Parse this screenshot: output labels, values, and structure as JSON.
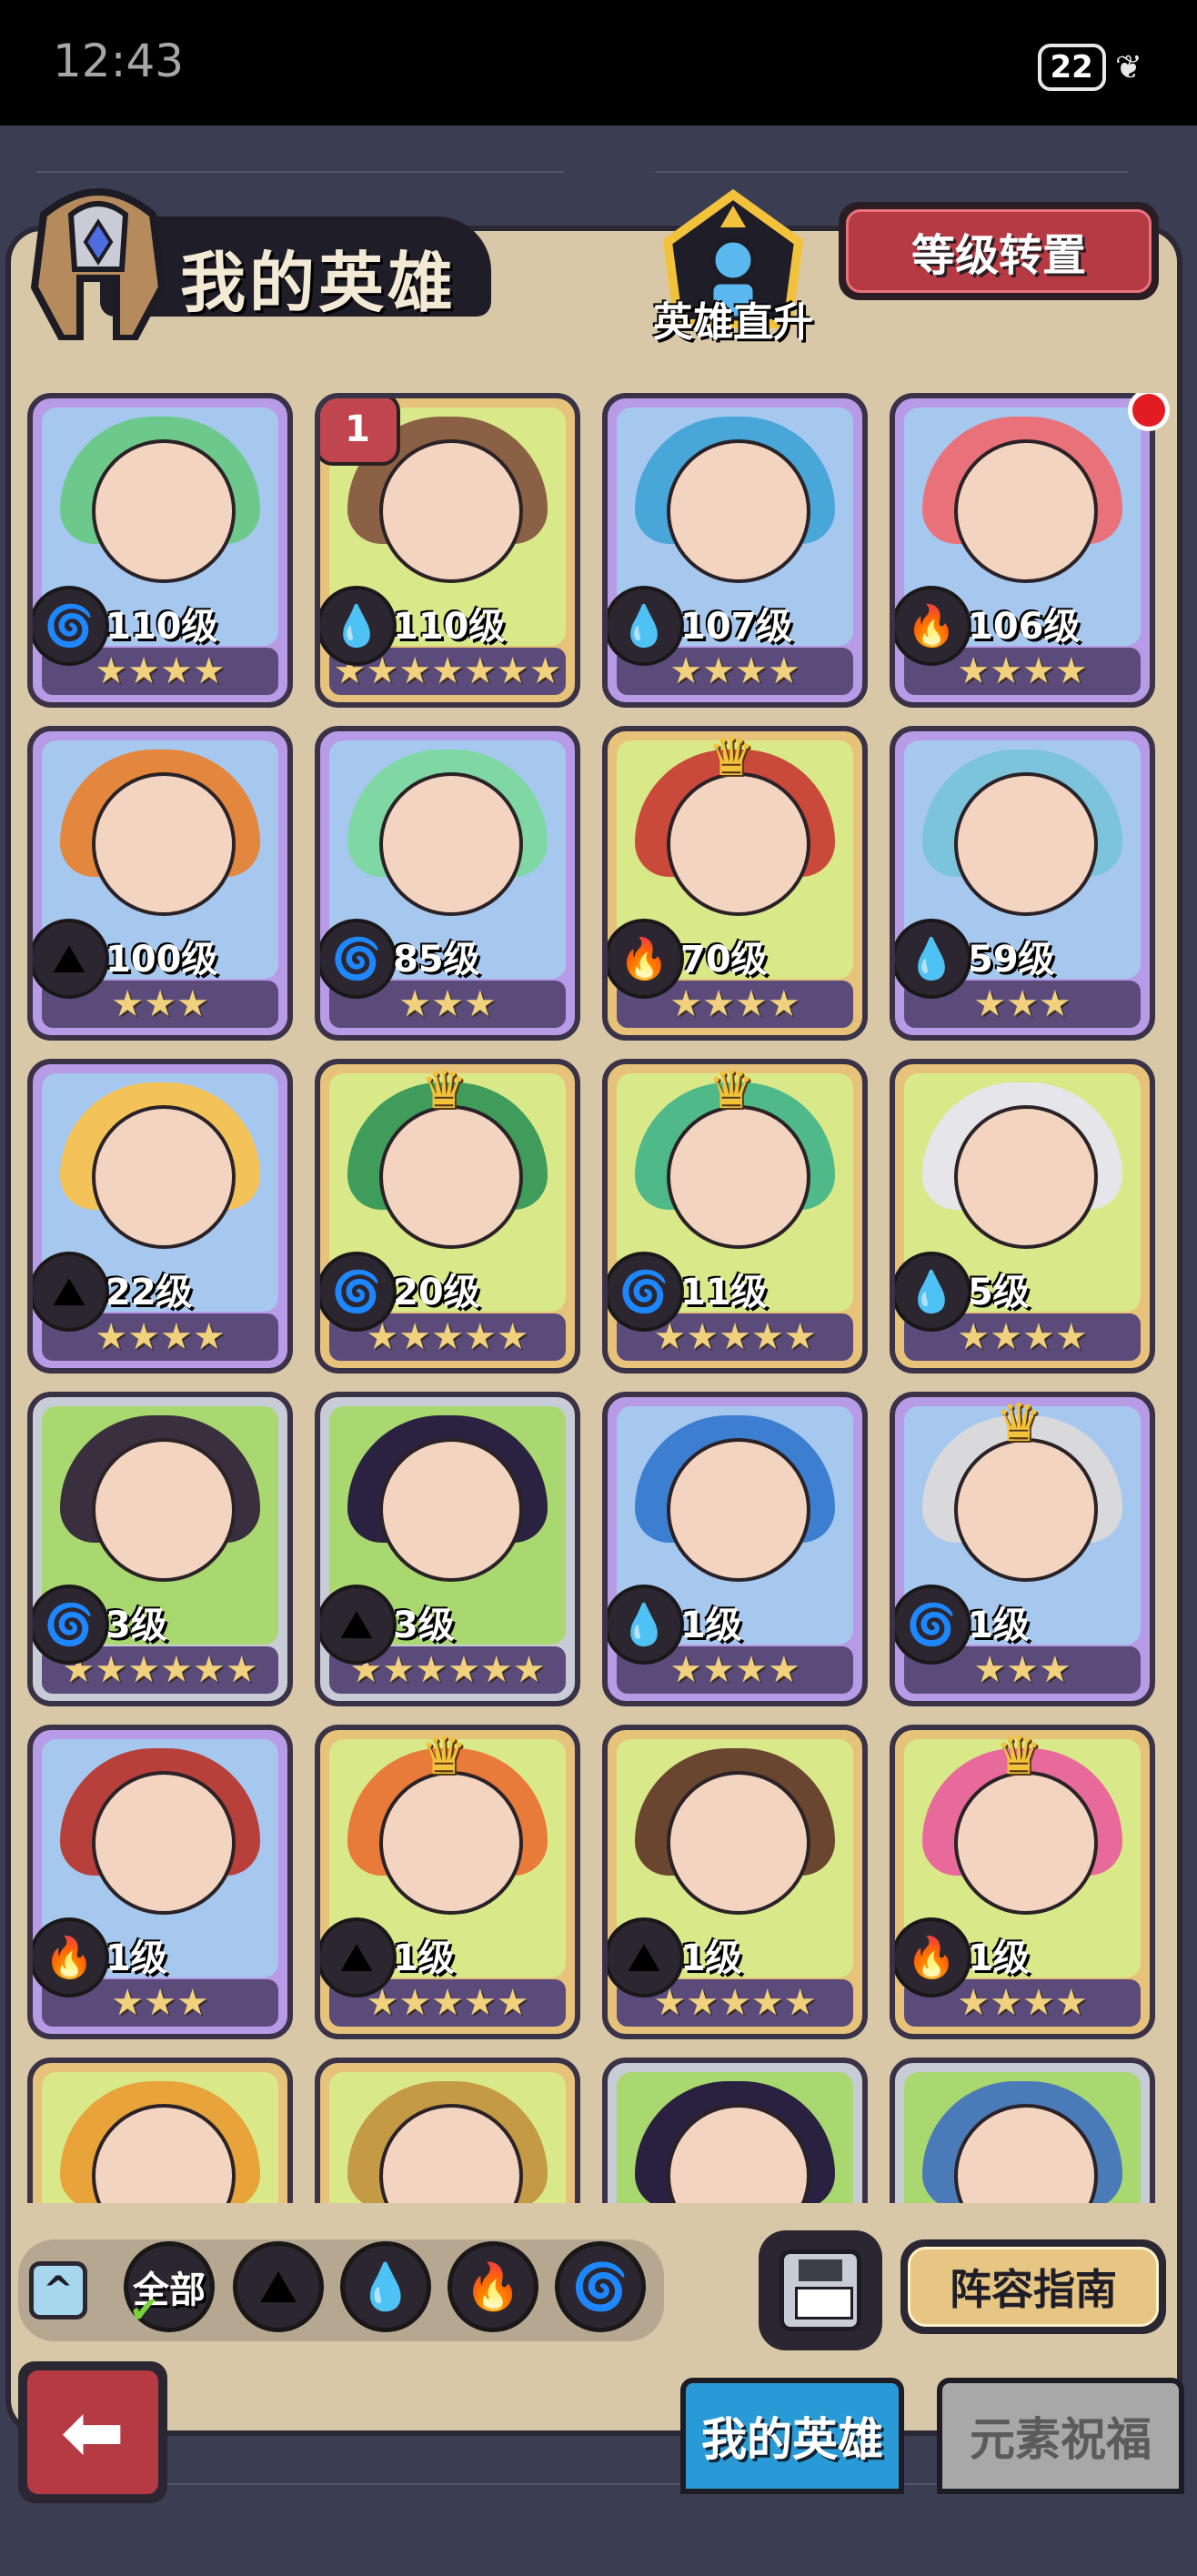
{
  "status_bar": {
    "time": "12:43",
    "battery": "22"
  },
  "header": {
    "title": "我的英雄",
    "rise_label": "英雄直升",
    "level_transfer": "等级转置"
  },
  "heroes": [
    {
      "level": "110级",
      "stars": "★★★★",
      "element": "wind",
      "frame": "purple",
      "color": "#6cc98b"
    },
    {
      "level": "110级",
      "stars": "★★★★★★★",
      "element": "water",
      "frame": "gold",
      "color": "#8a6144",
      "badge": "1"
    },
    {
      "level": "107级",
      "stars": "★★★★",
      "element": "water",
      "frame": "purple",
      "color": "#49a6d8"
    },
    {
      "level": "106级",
      "stars": "★★★★",
      "element": "fire",
      "frame": "purple",
      "color": "#e9727a",
      "dot": true
    },
    {
      "level": "100级",
      "stars": "★★★",
      "element": "earth",
      "frame": "purple",
      "color": "#e2873d"
    },
    {
      "level": "85级",
      "stars": "★★★",
      "element": "wind",
      "frame": "purple",
      "color": "#7fd7a4"
    },
    {
      "level": "70级",
      "stars": "★★★★",
      "element": "fire",
      "frame": "gold",
      "color": "#c94a3a",
      "crown": true
    },
    {
      "level": "59级",
      "stars": "★★★",
      "element": "water",
      "frame": "purple",
      "color": "#7cc3dc"
    },
    {
      "level": "22级",
      "stars": "★★★★",
      "element": "earth",
      "frame": "purple",
      "color": "#f3c35a"
    },
    {
      "level": "20级",
      "stars": "★★★★★",
      "element": "wind",
      "frame": "gold",
      "color": "#3f9c5a",
      "crown": true
    },
    {
      "level": "11级",
      "stars": "★★★★★",
      "element": "wind",
      "frame": "gold",
      "color": "#4fb98a",
      "crown": true
    },
    {
      "level": "5级",
      "stars": "★★★★",
      "element": "water",
      "frame": "gold",
      "color": "#e6e6ea"
    },
    {
      "level": "3级",
      "stars": "★★★★★★",
      "element": "wind",
      "frame": "silver",
      "color": "#3a2f3e"
    },
    {
      "level": "3级",
      "stars": "★★★★★★",
      "element": "earth",
      "frame": "silver",
      "color": "#2a2240"
    },
    {
      "level": "1级",
      "stars": "★★★★",
      "element": "water",
      "frame": "purple",
      "color": "#3c7ed0"
    },
    {
      "level": "1级",
      "stars": "★★★",
      "element": "wind",
      "frame": "purple",
      "color": "#d9d9dc",
      "crown": true
    },
    {
      "level": "1级",
      "stars": "★★★",
      "element": "fire",
      "frame": "purple",
      "color": "#b8403a"
    },
    {
      "level": "1级",
      "stars": "★★★★★",
      "element": "earth",
      "frame": "gold",
      "color": "#e87a3a",
      "crown": true
    },
    {
      "level": "1级",
      "stars": "★★★★★",
      "element": "earth",
      "frame": "gold",
      "color": "#6a4630"
    },
    {
      "level": "1级",
      "stars": "★★★★",
      "element": "fire",
      "frame": "gold",
      "color": "#e86a9a",
      "crown": true
    },
    {
      "level": "",
      "stars": "",
      "element": "",
      "frame": "gold",
      "color": "#e8a33a"
    },
    {
      "level": "",
      "stars": "",
      "element": "",
      "frame": "gold",
      "color": "#c59a45"
    },
    {
      "level": "",
      "stars": "",
      "element": "",
      "frame": "silver",
      "color": "#2a2040"
    },
    {
      "level": "",
      "stars": "",
      "element": "",
      "frame": "silver",
      "color": "#4a7ab8"
    }
  ],
  "icons": {
    "wind": "🌀",
    "water": "💧",
    "fire": "🔥",
    "earth": "⛰",
    "collapse": "^",
    "back": "⬅"
  },
  "filters": {
    "all": "全部"
  },
  "buttons": {
    "guide": "阵容指南"
  },
  "tabs": {
    "my_heroes": "我的英雄",
    "element_blessing": "元素祝福"
  }
}
